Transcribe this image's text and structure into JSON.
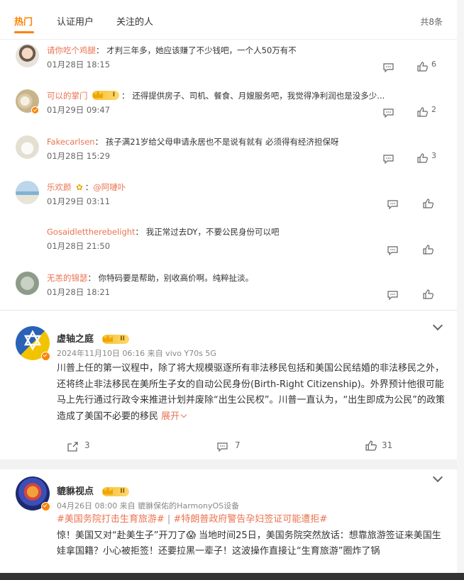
{
  "tabs": {
    "hot": "热门",
    "verified": "认证用户",
    "following": "关注的人",
    "total": "共8条"
  },
  "comments": [
    {
      "user": "请你吃个鸡腿",
      "sep": "：",
      "text": "才判三年多，她应该赚了不少钱吧，一个人50万有不",
      "time": "01月28日 18:15",
      "likes": "6"
    },
    {
      "user": "可以的掌门",
      "sep": "：",
      "text": "还得提供房子、司机、餐食、月嫂服务吧，我觉得净利润也是没多少...",
      "time": "01月29日 09:47",
      "likes": "2"
    },
    {
      "user": "Fakecarlsen",
      "sep": "：",
      "text": "孩子满21岁给父母申请永居也不是说有就有 必须得有经济担保呀",
      "time": "01月28日 15:29",
      "likes": "3"
    },
    {
      "user": "乐欢颜",
      "sep": "：",
      "text": "@阿嗹卟",
      "time": "01月29日 03:11",
      "likes": ""
    },
    {
      "user": "Gosaidlettherebelight",
      "sep": "：",
      "text": "我正常过去DY，不要公民身份可以吧",
      "time": "01月28日 21:50",
      "likes": ""
    },
    {
      "user": "无恙的锦瑟",
      "sep": "：",
      "text": "你特码要是帮助，别收高价啊。纯粹扯淡。",
      "time": "01月28日 18:21",
      "likes": ""
    }
  ],
  "post1": {
    "name": "虚轴之庭",
    "level": "II",
    "meta": "2024年11月10日 06:16  来自 vivo Y70s 5G",
    "text": "川普上任的第一议程中，除了将大规模驱逐所有非法移民包括和美国公民结婚的非法移民之外，还将终止非法移民在美所生子女的自动公民身份(Birth-Right Citizenship)。外界预计他很可能马上先行通过行政令来推进计划并废除“出生公民权”。川普一直认为，“出生即成为公民”的政策造成了美国不必要的移民",
    "expand": "展开",
    "reposts": "3",
    "comments": "7",
    "likes": "31"
  },
  "post2": {
    "name": "貔貅视点",
    "level": "II",
    "meta": "04月26日 08:00  来自 貔貅保佑的HarmonyOS设备",
    "tag1": "#美国务院打击生育旅游#",
    "sep": " | ",
    "tag2": "#特朗普政府警告孕妇签证可能遭拒#",
    "text": "惊！美国又对“赴美生子”开刀了😱 当地时间25日，美国务院突然放话：想靠旅游签证来美国生娃拿国籍？小心被拒签！还要拉黑一辈子！这波操作直接让“生育旅游”圈炸了锅"
  },
  "colors": {
    "accent": "#ff8200",
    "username": "#eb7350",
    "divider": "#f2f2f2"
  }
}
